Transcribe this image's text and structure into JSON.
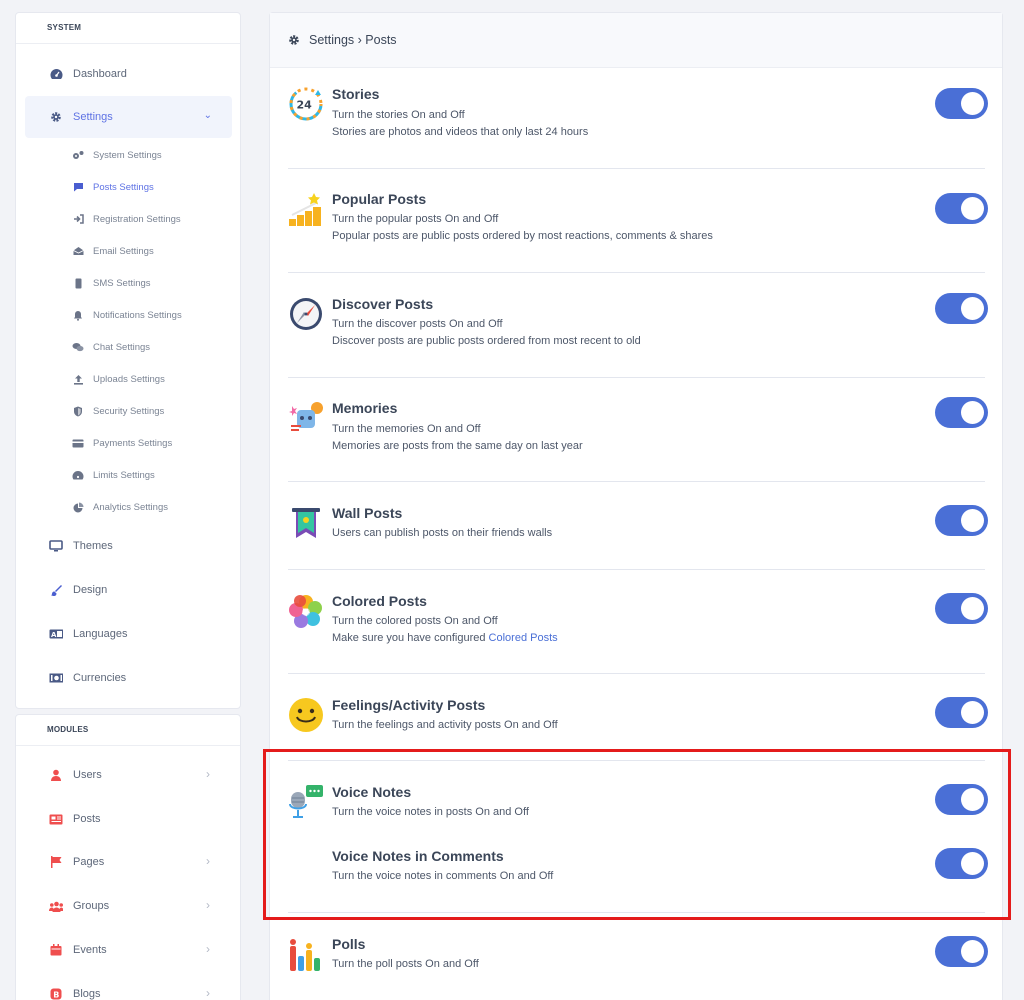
{
  "sidebar": {
    "system_header": "SYSTEM",
    "modules_header": "MODULES",
    "items": [
      {
        "label": "Dashboard",
        "icon": "dashboard-icon"
      },
      {
        "label": "Settings",
        "icon": "gear-icon"
      },
      {
        "label": "Themes",
        "icon": "monitor-icon"
      },
      {
        "label": "Design",
        "icon": "paint-brush-icon"
      },
      {
        "label": "Languages",
        "icon": "language-icon"
      },
      {
        "label": "Currencies",
        "icon": "money-icon"
      }
    ],
    "sub_items": [
      {
        "label": "System Settings",
        "icon": "cogs-icon"
      },
      {
        "label": "Posts Settings",
        "icon": "comment-icon"
      },
      {
        "label": "Registration Settings",
        "icon": "sign-in-icon"
      },
      {
        "label": "Email Settings",
        "icon": "envelope-icon"
      },
      {
        "label": "SMS Settings",
        "icon": "mobile-icon"
      },
      {
        "label": "Notifications Settings",
        "icon": "bell-icon"
      },
      {
        "label": "Chat Settings",
        "icon": "comments-icon"
      },
      {
        "label": "Uploads Settings",
        "icon": "upload-icon"
      },
      {
        "label": "Security Settings",
        "icon": "shield-icon"
      },
      {
        "label": "Payments Settings",
        "icon": "credit-card-icon"
      },
      {
        "label": "Limits Settings",
        "icon": "gauge-icon"
      },
      {
        "label": "Analytics Settings",
        "icon": "pie-chart-icon"
      }
    ],
    "modules": [
      {
        "label": "Users",
        "icon": "user-icon"
      },
      {
        "label": "Posts",
        "icon": "newspaper-icon"
      },
      {
        "label": "Pages",
        "icon": "flag-icon"
      },
      {
        "label": "Groups",
        "icon": "users-icon"
      },
      {
        "label": "Events",
        "icon": "calendar-icon"
      },
      {
        "label": "Blogs",
        "icon": "blog-icon"
      }
    ]
  },
  "main": {
    "breadcrumb": "Settings › Posts",
    "rows": [
      {
        "title": "Stories",
        "desc1": "Turn the stories On and Off",
        "desc2": "Stories are photos and videos that only last 24 hours",
        "enabled": true
      },
      {
        "title": "Popular Posts",
        "desc1": "Turn the popular posts On and Off",
        "desc2": "Popular posts are public posts ordered by most reactions, comments & shares",
        "enabled": true
      },
      {
        "title": "Discover Posts",
        "desc1": "Turn the discover posts On and Off",
        "desc2": "Discover posts are public posts ordered from most recent to old",
        "enabled": true
      },
      {
        "title": "Memories",
        "desc1": "Turn the memories On and Off",
        "desc2": "Memories are posts from the same day on last year",
        "enabled": true
      },
      {
        "title": "Wall Posts",
        "desc1": "Users can publish posts on their friends walls",
        "enabled": true
      },
      {
        "title": "Colored Posts",
        "desc1": "Turn the colored posts On and Off",
        "desc2": "Make sure you have configured ",
        "desc2_link": "Colored Posts",
        "enabled": true
      },
      {
        "title": "Feelings/Activity Posts",
        "desc1": "Turn the feelings and activity posts On and Off",
        "enabled": true
      },
      {
        "title": "Voice Notes",
        "desc1": "Turn the voice notes in posts On and Off",
        "enabled": true
      },
      {
        "title": "Voice Notes in Comments",
        "desc1": "Turn the voice notes in comments On and Off",
        "enabled": true
      },
      {
        "title": "Polls",
        "desc1": "Turn the poll posts On and Off",
        "enabled": true
      }
    ]
  },
  "colors": {
    "accent": "#5e72e4",
    "toggle_on": "#4a6fd6",
    "highlight": "#e41b1b",
    "modules_icon": "#ef4e4e"
  }
}
